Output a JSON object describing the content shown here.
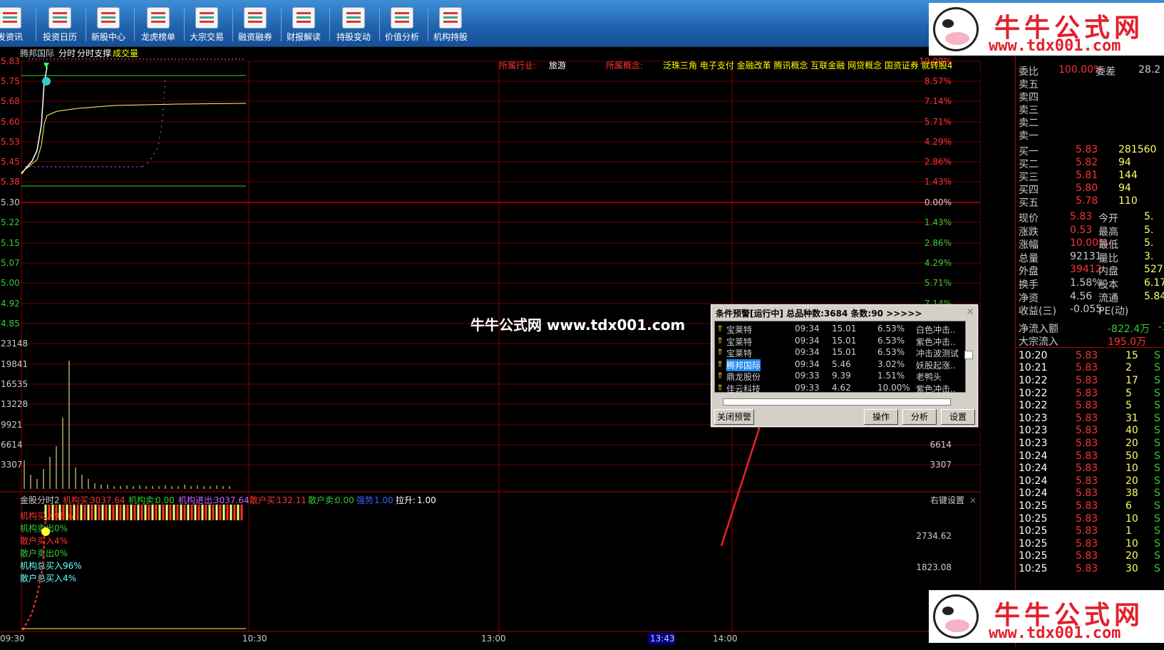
{
  "toolbar": {
    "items": [
      "发资讯",
      "投资日历",
      "新股中心",
      "龙虎榜单",
      "大宗交易",
      "融资融券",
      "财报解读",
      "持股变动",
      "价值分析",
      "机构持股"
    ]
  },
  "watermark": {
    "brand": "牛牛公式网",
    "url": "www.tdx001.com",
    "mid_text": "牛牛公式网 www.tdx001.com"
  },
  "header": {
    "stock_name": "腾邦国际",
    "tab_fenshi": "分时",
    "tab_support": "分时支撑",
    "tab_volume": "成交量",
    "industry_label": "所属行业:",
    "industry_value": "旅游",
    "concept_label": "所属概念:",
    "concept_value": "泛珠三角 电子支付 金融改革 腾讯概念 互联金融 网贷概念 国资证券 就转股4"
  },
  "price_axis": {
    "left": [
      "5.83",
      "5.75",
      "5.68",
      "5.60",
      "5.53",
      "5.45",
      "5.38",
      "5.30",
      "5.22",
      "5.15",
      "5.07",
      "5.00",
      "4.92",
      "4.85"
    ],
    "right": [
      "8.57%",
      "7.14%",
      "5.71%",
      "4.29%",
      "2.86%",
      "1.43%",
      "0.00%",
      "1.43%",
      "2.86%",
      "4.29%",
      "5.71%",
      "7.14%",
      "8.57%"
    ],
    "top_right": "10.00%"
  },
  "volume_axis": {
    "left": [
      "23148",
      "19841",
      "16535",
      "13228",
      "9921",
      "6614",
      "3307"
    ],
    "right": [
      "23148",
      "19841",
      "16535",
      "11806",
      "9921",
      "6614",
      "3307"
    ]
  },
  "indicator": {
    "name": "金股分时2",
    "jg_buy_label": "机构买:",
    "jg_buy": "3037.64",
    "jg_sell_label": "机构卖:",
    "jg_sell": "0.00",
    "jg_net_label": "机构进出:",
    "jg_net": "3037.64",
    "sh_buy_label": "散户买:",
    "sh_buy": "132.11",
    "sh_sell_label": "散户卖:",
    "sh_sell": "0.00",
    "strong_label": "强势",
    "strong": "1.00",
    "lift_label": "拉升:",
    "lift": "1.00",
    "settings": "右键设置",
    "close": "×",
    "legend": [
      "机构买入96%",
      "机构卖出0%",
      "散户买入4%",
      "散户卖出0%",
      "机构总买入96%",
      "散户总买入4%"
    ],
    "axis": [
      "2734.62",
      "1823.08"
    ]
  },
  "time_axis": [
    "09:30",
    "10:30",
    "13:00",
    "13:43",
    "14:00"
  ],
  "dialog": {
    "title": "条件预警[运行中] 总品种数:3684 条数:90  >>>>>",
    "rows": [
      {
        "name": "宝莱特",
        "time": "09:34",
        "price": "15.01",
        "pct": "6.53%",
        "cond": "白色冲击.."
      },
      {
        "name": "宝莱特",
        "time": "09:34",
        "price": "15.01",
        "pct": "6.53%",
        "cond": "紫色冲击.."
      },
      {
        "name": "宝莱特",
        "time": "09:34",
        "price": "15.01",
        "pct": "6.53%",
        "cond": "冲击波测试"
      },
      {
        "name": "腾邦国际",
        "time": "09:34",
        "price": "5.46",
        "pct": "3.02%",
        "cond": "妖股起涨.."
      },
      {
        "name": "鼎龙股份",
        "time": "09:33",
        "price": "9.39",
        "pct": "1.51%",
        "cond": "老鸭头"
      },
      {
        "name": "佳云科技",
        "time": "09:33",
        "price": "4.62",
        "pct": "10.00%",
        "cond": "紫色冲击.."
      }
    ],
    "close_btn": "关闭预警",
    "op_btn": "操作",
    "analyze_btn": "分析",
    "settings_btn": "设置"
  },
  "quote": {
    "weibi_label": "委比",
    "weibi": "100.00%",
    "weicha_label": "委差",
    "weicha": "28.2",
    "sell": [
      "卖五",
      "卖四",
      "卖三",
      "卖二",
      "卖一"
    ],
    "buy": [
      {
        "label": "买一",
        "price": "5.83",
        "vol": "281560"
      },
      {
        "label": "买二",
        "price": "5.82",
        "vol": "94"
      },
      {
        "label": "买三",
        "price": "5.81",
        "vol": "144"
      },
      {
        "label": "买四",
        "price": "5.80",
        "vol": "94"
      },
      {
        "label": "买五",
        "price": "5.78",
        "vol": "110"
      }
    ],
    "stats": [
      {
        "l1": "现价",
        "v1": "5.83",
        "l2": "今开",
        "v2": "5."
      },
      {
        "l1": "涨跌",
        "v1": "0.53",
        "l2": "最高",
        "v2": "5."
      },
      {
        "l1": "涨幅",
        "v1": "10.00%",
        "l2": "最低",
        "v2": "5."
      },
      {
        "l1": "总量",
        "v1": "92131",
        "l2": "量比",
        "v2": "3."
      },
      {
        "l1": "外盘",
        "v1": "39412",
        "l2": "内盘",
        "v2": "527"
      },
      {
        "l1": "换手",
        "v1": "1.58%",
        "l2": "股本",
        "v2": "6.17"
      },
      {
        "l1": "净资",
        "v1": "4.56",
        "l2": "流通",
        "v2": "5.84"
      },
      {
        "l1": "收益(三)",
        "v1": "-0.055",
        "l2": "PE(动)",
        "v2": ""
      }
    ],
    "netflow_label": "净流入额",
    "netflow": "-822.4万",
    "netflow2": "-1",
    "bigflow_label": "大宗流入",
    "bigflow": "195.0万",
    "ticks": [
      {
        "t": "10:20",
        "p": "5.83",
        "v": "15"
      },
      {
        "t": "10:21",
        "p": "5.83",
        "v": "2"
      },
      {
        "t": "10:22",
        "p": "5.83",
        "v": "17"
      },
      {
        "t": "10:22",
        "p": "5.83",
        "v": "5"
      },
      {
        "t": "10:22",
        "p": "5.83",
        "v": "5"
      },
      {
        "t": "10:23",
        "p": "5.83",
        "v": "31"
      },
      {
        "t": "10:23",
        "p": "5.83",
        "v": "40"
      },
      {
        "t": "10:23",
        "p": "5.83",
        "v": "20"
      },
      {
        "t": "10:24",
        "p": "5.83",
        "v": "50"
      },
      {
        "t": "10:24",
        "p": "5.83",
        "v": "10"
      },
      {
        "t": "10:24",
        "p": "5.83",
        "v": "20"
      },
      {
        "t": "10:24",
        "p": "5.83",
        "v": "38"
      },
      {
        "t": "10:25",
        "p": "5.83",
        "v": "6"
      },
      {
        "t": "10:25",
        "p": "5.83",
        "v": "10"
      },
      {
        "t": "10:25",
        "p": "5.83",
        "v": "1"
      },
      {
        "t": "10:25",
        "p": "5.83",
        "v": "10"
      },
      {
        "t": "10:25",
        "p": "5.83",
        "v": "20"
      },
      {
        "t": "10:25",
        "p": "5.83",
        "v": "30"
      }
    ],
    "tick_side": "S"
  }
}
